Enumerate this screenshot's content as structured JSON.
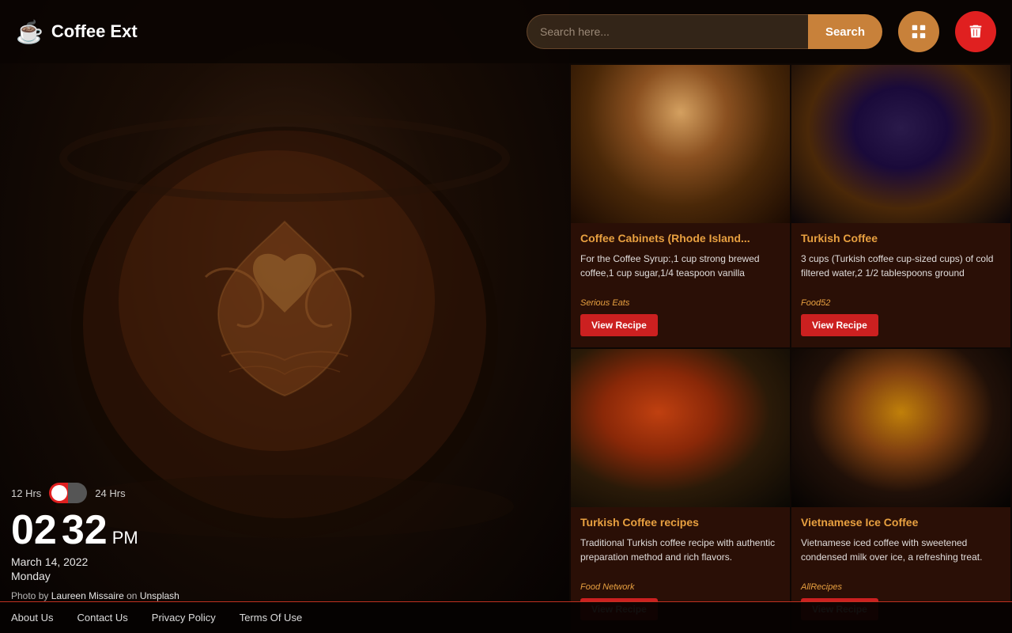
{
  "app": {
    "name": "Coffee Ext",
    "logo_icon": "☕"
  },
  "header": {
    "search_placeholder": "Search here...",
    "search_button_label": "Search",
    "gallery_icon": "gallery-icon",
    "delete_icon": "delete-icon"
  },
  "clock": {
    "format_12": "12 Hrs",
    "format_24": "24 Hrs",
    "hours": "02",
    "minutes": "32",
    "ampm": "PM",
    "date": "March 14, 2022",
    "day": "Monday",
    "photo_credit_prefix": "Photo by",
    "photographer": "Laureen Missaire",
    "photo_platform_connector": "on",
    "photo_platform": "Unsplash"
  },
  "recipes": [
    {
      "id": 1,
      "title": "Coffee Cabinets (Rhode Island...",
      "description": "For the Coffee Syrup:,1 cup strong brewed coffee,1 cup sugar,1/4 teaspoon vanilla",
      "source": "Serious Eats",
      "view_label": "View Recipe",
      "img_class": "recipe-img-1"
    },
    {
      "id": 2,
      "title": "Turkish Coffee",
      "description": "3 cups (Turkish coffee cup-sized cups) of cold filtered water,2 1/2 tablespoons ground",
      "source": "Food52",
      "view_label": "View Recipe",
      "img_class": "recipe-img-2"
    },
    {
      "id": 3,
      "title": "Turkish Coffee recipes",
      "description": "Traditional Turkish coffee recipe with authentic preparation method and rich flavors.",
      "source": "Food Network",
      "view_label": "View Recipe",
      "img_class": "recipe-img-3"
    },
    {
      "id": 4,
      "title": "Vietnamese Ice Coffee",
      "description": "Vietnamese iced coffee with sweetened condensed milk over ice, a refreshing treat.",
      "source": "AllRecipes",
      "view_label": "View Recipe",
      "img_class": "recipe-img-4"
    }
  ],
  "footer": {
    "links": [
      {
        "label": "About Us",
        "id": "about-us"
      },
      {
        "label": "Contact Us",
        "id": "contact-us"
      },
      {
        "label": "Privacy Policy",
        "id": "privacy-policy"
      },
      {
        "label": "Terms Of Use",
        "id": "terms-of-use"
      }
    ]
  }
}
